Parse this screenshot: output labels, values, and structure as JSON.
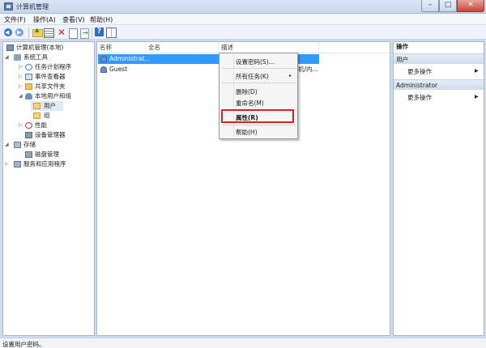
{
  "window": {
    "title": "计算机管理"
  },
  "menubar": {
    "items": [
      "文件(F)",
      "操作(A)",
      "查看(V)",
      "帮助(H)"
    ]
  },
  "tree": {
    "items": [
      {
        "label": "计算机管理(本地)"
      },
      {
        "label": "系统工具"
      },
      {
        "label": "任务计划程序"
      },
      {
        "label": "事件查看器"
      },
      {
        "label": "共享文件夹"
      },
      {
        "label": "本地用户和组"
      },
      {
        "label": "用户"
      },
      {
        "label": "组"
      },
      {
        "label": "性能"
      },
      {
        "label": "设备管理器"
      },
      {
        "label": "存储"
      },
      {
        "label": "磁盘管理"
      },
      {
        "label": "服务和应用程序"
      }
    ]
  },
  "list": {
    "columns": [
      "名称",
      "全名",
      "描述"
    ],
    "rows": [
      {
        "name": "Administrat...",
        "desc": ""
      },
      {
        "name": "Guest",
        "desc": "机/内..."
      }
    ]
  },
  "context_menu": {
    "items": [
      {
        "label": "设置密码(S)..."
      },
      {
        "label": "所有任务(K)",
        "submenu": "▸"
      },
      {
        "label": "删除(D)"
      },
      {
        "label": "重命名(M)"
      },
      {
        "label": "属性(R)"
      },
      {
        "label": "帮助(H)"
      }
    ]
  },
  "actions": {
    "title": "操作",
    "sections": [
      {
        "label": "用户",
        "item": "更多操作"
      },
      {
        "label": "Administrator",
        "item": "更多操作"
      }
    ]
  },
  "status": {
    "text": "设置用户密码。"
  },
  "colors": {
    "selection": "#3399ff",
    "highlight_box": "#d32424"
  }
}
